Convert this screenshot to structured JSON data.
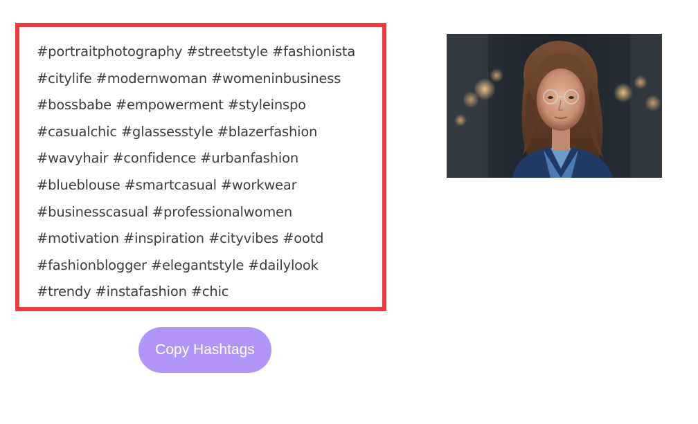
{
  "hashtags": {
    "lines": [
      "#portraitphotography #streetstyle #fashionista",
      "#citylife #modernwoman #womeninbusiness",
      "#bossbabe #empowerment #styleinspo",
      "#casualchic #glassesstyle #blazerfashion",
      "#wavyhair #confidence #urbanfashion",
      "#blueblouse #smartcasual #workwear",
      "#businesscasual #professionalwomen",
      "#motivation #inspiration #cityvibes #ootd",
      "#fashionblogger #elegantstyle #dailylook",
      "#trendy #instafashion #chic"
    ],
    "border_color": "#ee3b3f",
    "text_color": "#3c3c3c"
  },
  "copy_button": {
    "label": "Copy Hashtags",
    "color": "#b296f7"
  },
  "image": {
    "subject": "portrait-photo"
  }
}
